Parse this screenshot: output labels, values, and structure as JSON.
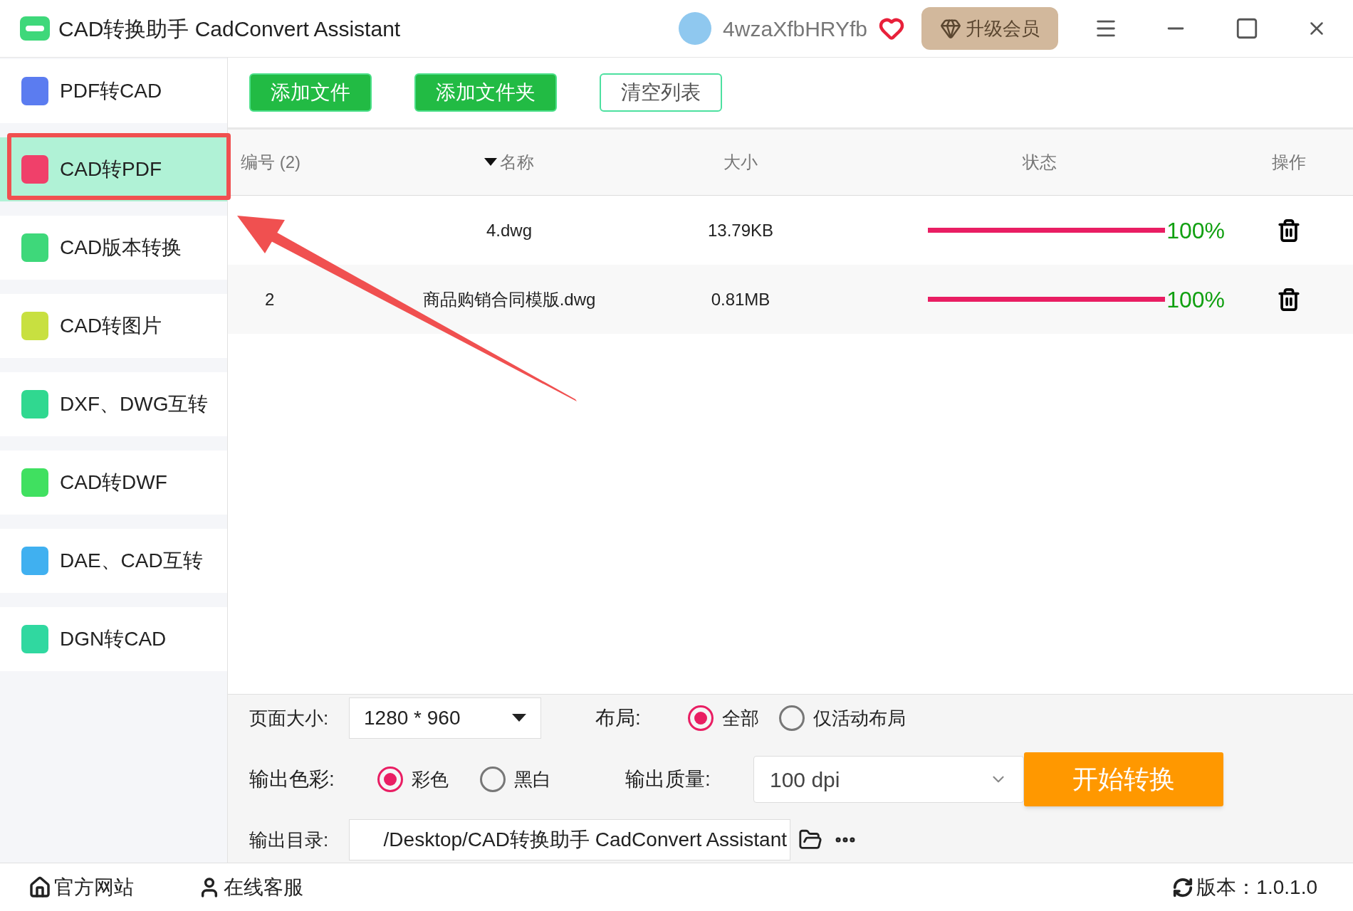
{
  "window": {
    "title": "CAD转换助手 CadConvert Assistant",
    "user": "4wzaXfbHRYfb",
    "upgrade": "升级会员"
  },
  "sidebar": {
    "items": [
      {
        "label": "PDF转CAD",
        "selected": false,
        "highlighted": false,
        "color": "#5b7cf0"
      },
      {
        "label": "CAD转PDF",
        "selected": true,
        "highlighted": true,
        "color": "#f0406a"
      },
      {
        "label": "CAD版本转换",
        "selected": false,
        "highlighted": false,
        "color": "#3ed87a"
      },
      {
        "label": "CAD转图片",
        "selected": false,
        "highlighted": false,
        "color": "#c8e040"
      },
      {
        "label": "DXF、DWG互转",
        "selected": false,
        "highlighted": false,
        "color": "#30d890"
      },
      {
        "label": "CAD转DWF",
        "selected": false,
        "highlighted": false,
        "color": "#40e060"
      },
      {
        "label": "DAE、CAD互转",
        "selected": false,
        "highlighted": false,
        "color": "#40b0f0"
      },
      {
        "label": "DGN转CAD",
        "selected": false,
        "highlighted": false,
        "color": "#30d8a0"
      }
    ]
  },
  "toolbar": [
    {
      "label": "添加文件",
      "kind": "filled"
    },
    {
      "label": "添加文件夹",
      "kind": "filled"
    },
    {
      "label": "清空列表",
      "kind": "outline"
    }
  ],
  "table": {
    "columns": [
      {
        "label": "编号 (2)",
        "sorted": false
      },
      {
        "label": "名称",
        "sorted": true
      },
      {
        "label": "大小",
        "sorted": false
      },
      {
        "label": "状态",
        "sorted": false
      },
      {
        "label": "操作",
        "sorted": false
      }
    ],
    "rows": [
      {
        "name": "4.dwg",
        "size": "13.79KB",
        "level": 1,
        "percent": "100%"
      },
      {
        "number": "2",
        "name": "商品购销合同模版.dwg",
        "size": "0.81MB",
        "level": 1,
        "percent": "100%"
      }
    ]
  },
  "settings": {
    "page_size": {
      "label": "页面大小:",
      "value": "1280 * 960"
    },
    "layout": {
      "label": "布局:",
      "options": [
        {
          "label": "全部",
          "selected": true
        },
        {
          "label": "仅活动布局",
          "selected": false
        }
      ]
    },
    "color": {
      "label": "输出色彩:",
      "options": [
        {
          "label": "彩色",
          "selected": true
        },
        {
          "label": "黑白",
          "selected": false
        }
      ]
    },
    "quality": {
      "label": "输出质量:",
      "value": "100 dpi"
    },
    "start": "开始转换",
    "output": {
      "label": "输出目录:",
      "value": "/Desktop/CAD转换助手 CadConvert Assistant"
    }
  },
  "annotation": {
    "arrow": true
  },
  "footer": {
    "links": [
      "官方网站",
      "在线客服"
    ],
    "version": "版本：1.0.1.0"
  }
}
